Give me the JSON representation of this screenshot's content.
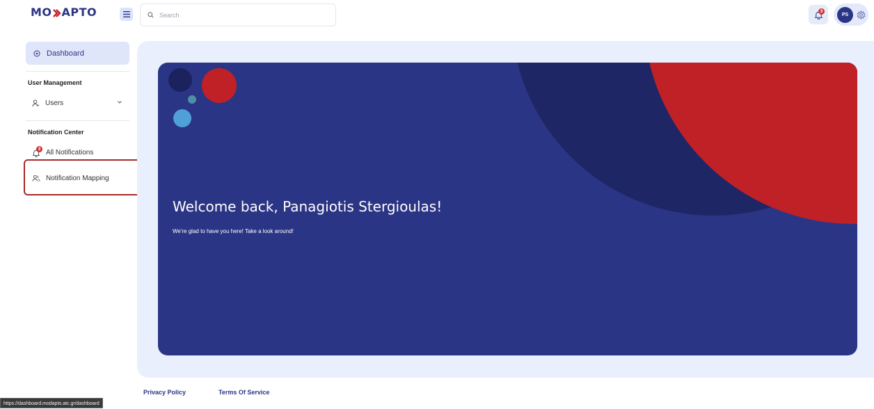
{
  "header": {
    "logo_left": "MO",
    "logo_right": "APTO",
    "search_placeholder": "Search",
    "notification_count": "3",
    "avatar_initials": "PS"
  },
  "sidebar": {
    "active_item": {
      "label": "Dashboard",
      "icon": "dashboard-icon"
    },
    "sections": [
      {
        "title": "User Management",
        "items": [
          {
            "label": "Users",
            "icon": "user-icon",
            "expandable": true
          }
        ]
      },
      {
        "title": "Notification Center",
        "items": [
          {
            "label": "All Notifications",
            "icon": "bell-icon",
            "badge": "3"
          },
          {
            "label": "Notification Mapping",
            "icon": "users-icon",
            "highlighted": true
          }
        ]
      }
    ]
  },
  "hero": {
    "title": "Welcome back, Panagiotis Stergioulas!",
    "subtitle": "We're glad to have you here! Take a look around!"
  },
  "footer": {
    "links": [
      "Privacy Policy",
      "Terms Of Service"
    ],
    "status_url": "https://dashboard.modapto.atc.gr/dashboard"
  },
  "colors": {
    "brand_navy": "#2b3585",
    "brand_red": "#c02126",
    "dark_navy": "#1e2665",
    "accent_light": "#dfe6fa",
    "highlight": "#a52a2a"
  }
}
